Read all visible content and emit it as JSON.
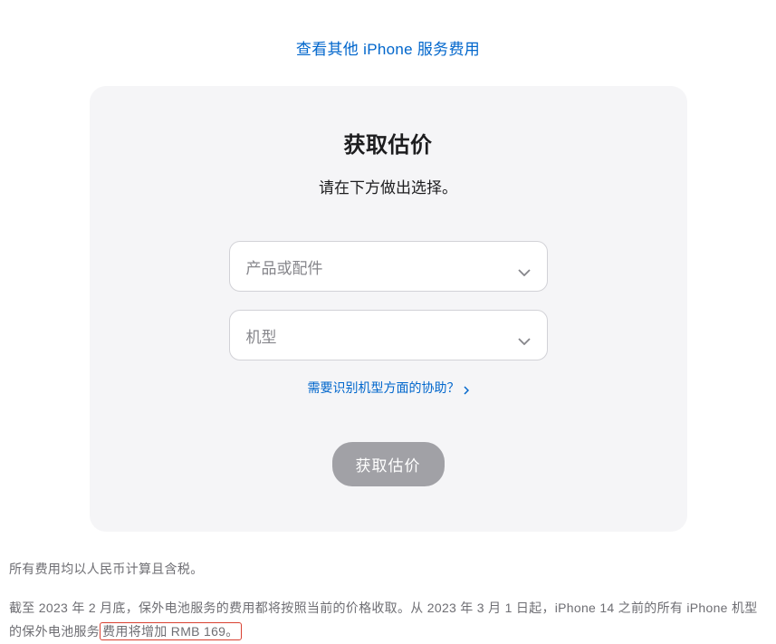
{
  "top_link": "查看其他 iPhone 服务费用",
  "card": {
    "title": "获取估价",
    "subtitle": "请在下方做出选择。",
    "select_product_placeholder": "产品或配件",
    "select_model_placeholder": "机型",
    "help_link_text": "需要识别机型方面的协助？",
    "submit_button": "获取估价"
  },
  "footer": {
    "line1": "所有费用均以人民币计算且含税。",
    "line2_part1": "截至 2023 年 2 月底，保外电池服务的费用都将按照当前的价格收取。从 2023 年 3 月 1 日起，iPhone 14 之前的所有 iPhone 机型的保外电池服务",
    "line2_highlight": "费用将增加 RMB 169。"
  }
}
